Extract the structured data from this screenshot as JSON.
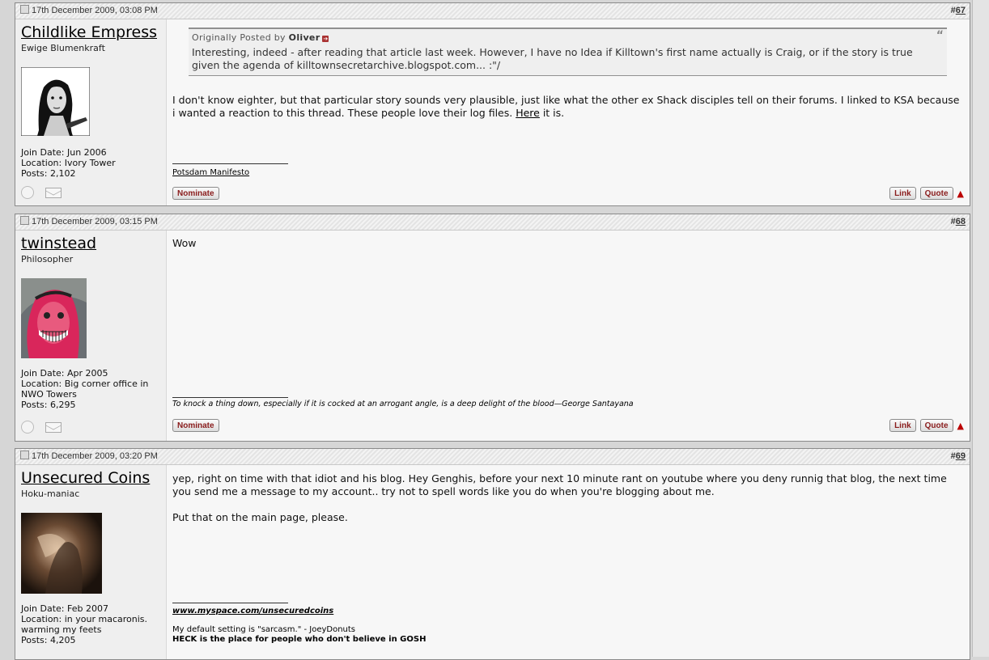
{
  "posts": [
    {
      "date": "17th December 2009, 03:08 PM",
      "number": "67",
      "username": "Childlike Empress",
      "usertitle": "Ewige Blumenkraft",
      "join": "Join Date: Jun 2006",
      "location": "Location: Ivory Tower",
      "posts": "Posts: 2,102",
      "quote": {
        "posted_by_label": "Originally Posted by",
        "author": "Oliver",
        "text": "Interesting, indeed - after reading that article last week. However, I have no Idea if Killtown's first name actually is Craig, or if the story is true given the agenda of killtownsecretarchive.blogspot.com... :\"/"
      },
      "message_a": "I don't know eighter, but that particular story sounds very plausible, just like what the other ex Shack disciples tell on their forums. I linked to KSA because i wanted a reaction to this thread. These people love their log files. ",
      "message_link": "Here",
      "message_b": " it is.",
      "signature": "Potsdam Manifesto"
    },
    {
      "date": "17th December 2009, 03:15 PM",
      "number": "68",
      "username": "twinstead",
      "usertitle": "Philosopher",
      "join": "Join Date: Apr 2005",
      "location": "Location: Big corner office in NWO Towers",
      "posts": "Posts: 6,295",
      "message": "Wow",
      "signature": "To knock a thing down, especially if it is cocked at an arrogant angle, is a deep delight of the blood—George Santayana"
    },
    {
      "date": "17th December 2009, 03:20 PM",
      "number": "69",
      "username": "Unsecured Coins",
      "usertitle": "Hoku-maniac",
      "join": "Join Date: Feb 2007",
      "location": "Location: in your macaronis. warming my feets",
      "posts": "Posts: 4,205",
      "message_p1": "yep, right on time with that idiot and his blog. Hey Genghis, before your next 10 minute rant on youtube where you deny runnig that blog, the next time you send me a message to my account.. try not to spell words like you do when you're blogging about me.",
      "message_p2": "Put that on the main page, please.",
      "sig_link": "www.myspace.com/unsecuredcoins",
      "sig_line2": "My default setting is \"sarcasm.\" - JoeyDonuts",
      "sig_line3": "HECK is the place for people who don't believe in GOSH"
    }
  ],
  "buttons": {
    "nominate": "Nominate",
    "link": "Link",
    "quote": "Quote"
  },
  "icons": {
    "post_icon": "post-status-icon",
    "online": "online-status-icon",
    "pm": "envelope-icon",
    "top": "back-to-top-arrow-icon"
  },
  "colors": {
    "button_text": "#8a1c1c",
    "up_arrow": "#b00000",
    "userinfo_bg": "#efefef",
    "page_bg": "#d6d6d6"
  }
}
